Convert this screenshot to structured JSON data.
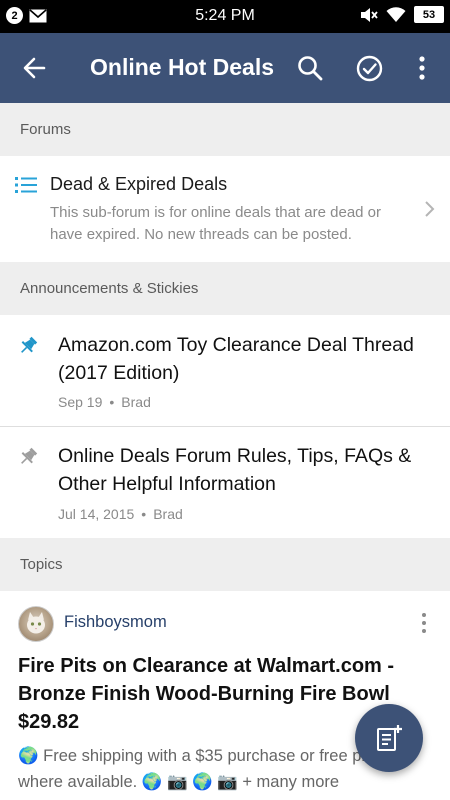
{
  "status_bar": {
    "notification_count": "2",
    "time": "5:24 PM",
    "battery": "53",
    "icons": [
      "notification-badge-icon",
      "mail-icon",
      "mute-icon",
      "wifi-icon",
      "battery-icon"
    ]
  },
  "app_bar": {
    "title": "Online Hot Deals",
    "background_color": "#3d5277",
    "icons": [
      "back-arrow-icon",
      "search-icon",
      "check-circle-icon",
      "more-vert-icon"
    ]
  },
  "sections": {
    "forums": "Forums",
    "announcements": "Announcements & Stickies",
    "topics": "Topics"
  },
  "forum": {
    "title": "Dead & Expired Deals",
    "description": "This sub-forum is for online deals that are dead or have expired. No new threads can be posted."
  },
  "stickies": [
    {
      "title": "Amazon.com Toy Clearance Deal Thread (2017 Edition)",
      "date": "Sep 19",
      "author": "Brad",
      "pin_color": "#2196c9"
    },
    {
      "title": "Online Deals Forum Rules, Tips, FAQs & Other Helpful Information",
      "date": "Jul 14, 2015",
      "author": "Brad",
      "pin_color": "#9e9e9e"
    }
  ],
  "topic": {
    "author": "Fishboysmom",
    "title": "Fire Pits on Clearance at Walmart.com - Bronze Finish Wood-Burning Fire Bowl $29.82",
    "snippet": "🌍 Free shipping with a $35 purchase or free pickup where available. 🌍 📷 🌍 📷 + many more"
  },
  "fab": {
    "icon": "new-thread-icon"
  }
}
